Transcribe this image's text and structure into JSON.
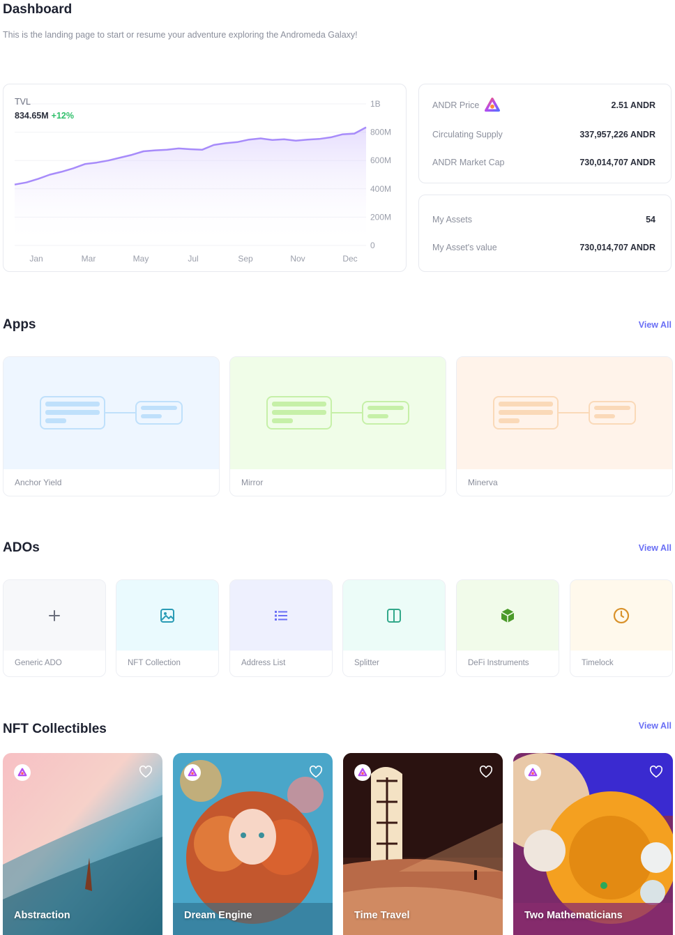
{
  "header": {
    "title": "Dashboard",
    "subtitle": "This is the landing page to start or resume your adventure exploring the Andromeda Galaxy!"
  },
  "tvl": {
    "label": "TVL",
    "value": "834.65M",
    "change": "+12%",
    "accent_color": "#a78bfa",
    "chart_data": {
      "type": "area",
      "x_tick_labels": [
        "Jan",
        "Mar",
        "May",
        "Jul",
        "Sep",
        "Nov",
        "Dec"
      ],
      "y_tick_labels": [
        "1B",
        "800M",
        "600M",
        "400M",
        "200M",
        "0"
      ],
      "ylim": [
        0,
        1000000000
      ],
      "series": [
        {
          "values": [
            430,
            445,
            470,
            500,
            520,
            545,
            575,
            585,
            600,
            620,
            640,
            665,
            672,
            676,
            685,
            680,
            676,
            710,
            722,
            730,
            748,
            756,
            745,
            750,
            740,
            748,
            752,
            764,
            785,
            790,
            834.65
          ]
        }
      ],
      "value_unit": "M",
      "grid": true
    }
  },
  "price_card": {
    "rows": [
      {
        "label": "ANDR Price",
        "value": "2.51 ANDR",
        "icon": "andromeda-logo-icon"
      },
      {
        "label": "Circulating Supply",
        "value": "337,957,226 ANDR"
      },
      {
        "label": "ANDR Market Cap",
        "value": "730,014,707 ANDR"
      }
    ]
  },
  "assets_card": {
    "rows": [
      {
        "label": "My Assets",
        "value": "54"
      },
      {
        "label": "My Asset's value",
        "value": "730,014,707 ANDR"
      }
    ]
  },
  "apps": {
    "title": "Apps",
    "view_all": "View All",
    "items": [
      {
        "label": "Anchor Yield",
        "bg": "#eef6ff",
        "accent": "#bfe0fb"
      },
      {
        "label": "Mirror",
        "bg": "#f0fde8",
        "accent": "#c6f0a8"
      },
      {
        "label": "Minerva",
        "bg": "#fff3ea",
        "accent": "#fad9b8"
      }
    ]
  },
  "ados": {
    "title": "ADOs",
    "view_all": "View All",
    "items": [
      {
        "label": "Generic ADO",
        "icon": "plus-icon",
        "bg": "#f7f8fa",
        "color": "#6b6f7c"
      },
      {
        "label": "NFT Collection",
        "icon": "image-icon",
        "bg": "#eafafe",
        "color": "#2a9bb5"
      },
      {
        "label": "Address List",
        "icon": "list-icon",
        "bg": "#eef0fe",
        "color": "#6a6ff5"
      },
      {
        "label": "Splitter",
        "icon": "splitter-icon",
        "bg": "#ecfcf8",
        "color": "#32a88a"
      },
      {
        "label": "DeFi Instruments",
        "icon": "cube-icon",
        "bg": "#f1fbea",
        "color": "#4b9a2a"
      },
      {
        "label": "Timelock",
        "icon": "clock-icon",
        "bg": "#fff9ec",
        "color": "#d9922b"
      }
    ]
  },
  "nfts": {
    "title": "NFT Collectibles",
    "view_all": "View All",
    "items": [
      {
        "title": "Abstraction"
      },
      {
        "title": "Dream Engine"
      },
      {
        "title": "Time Travel"
      },
      {
        "title": "Two Mathematicians"
      }
    ]
  }
}
